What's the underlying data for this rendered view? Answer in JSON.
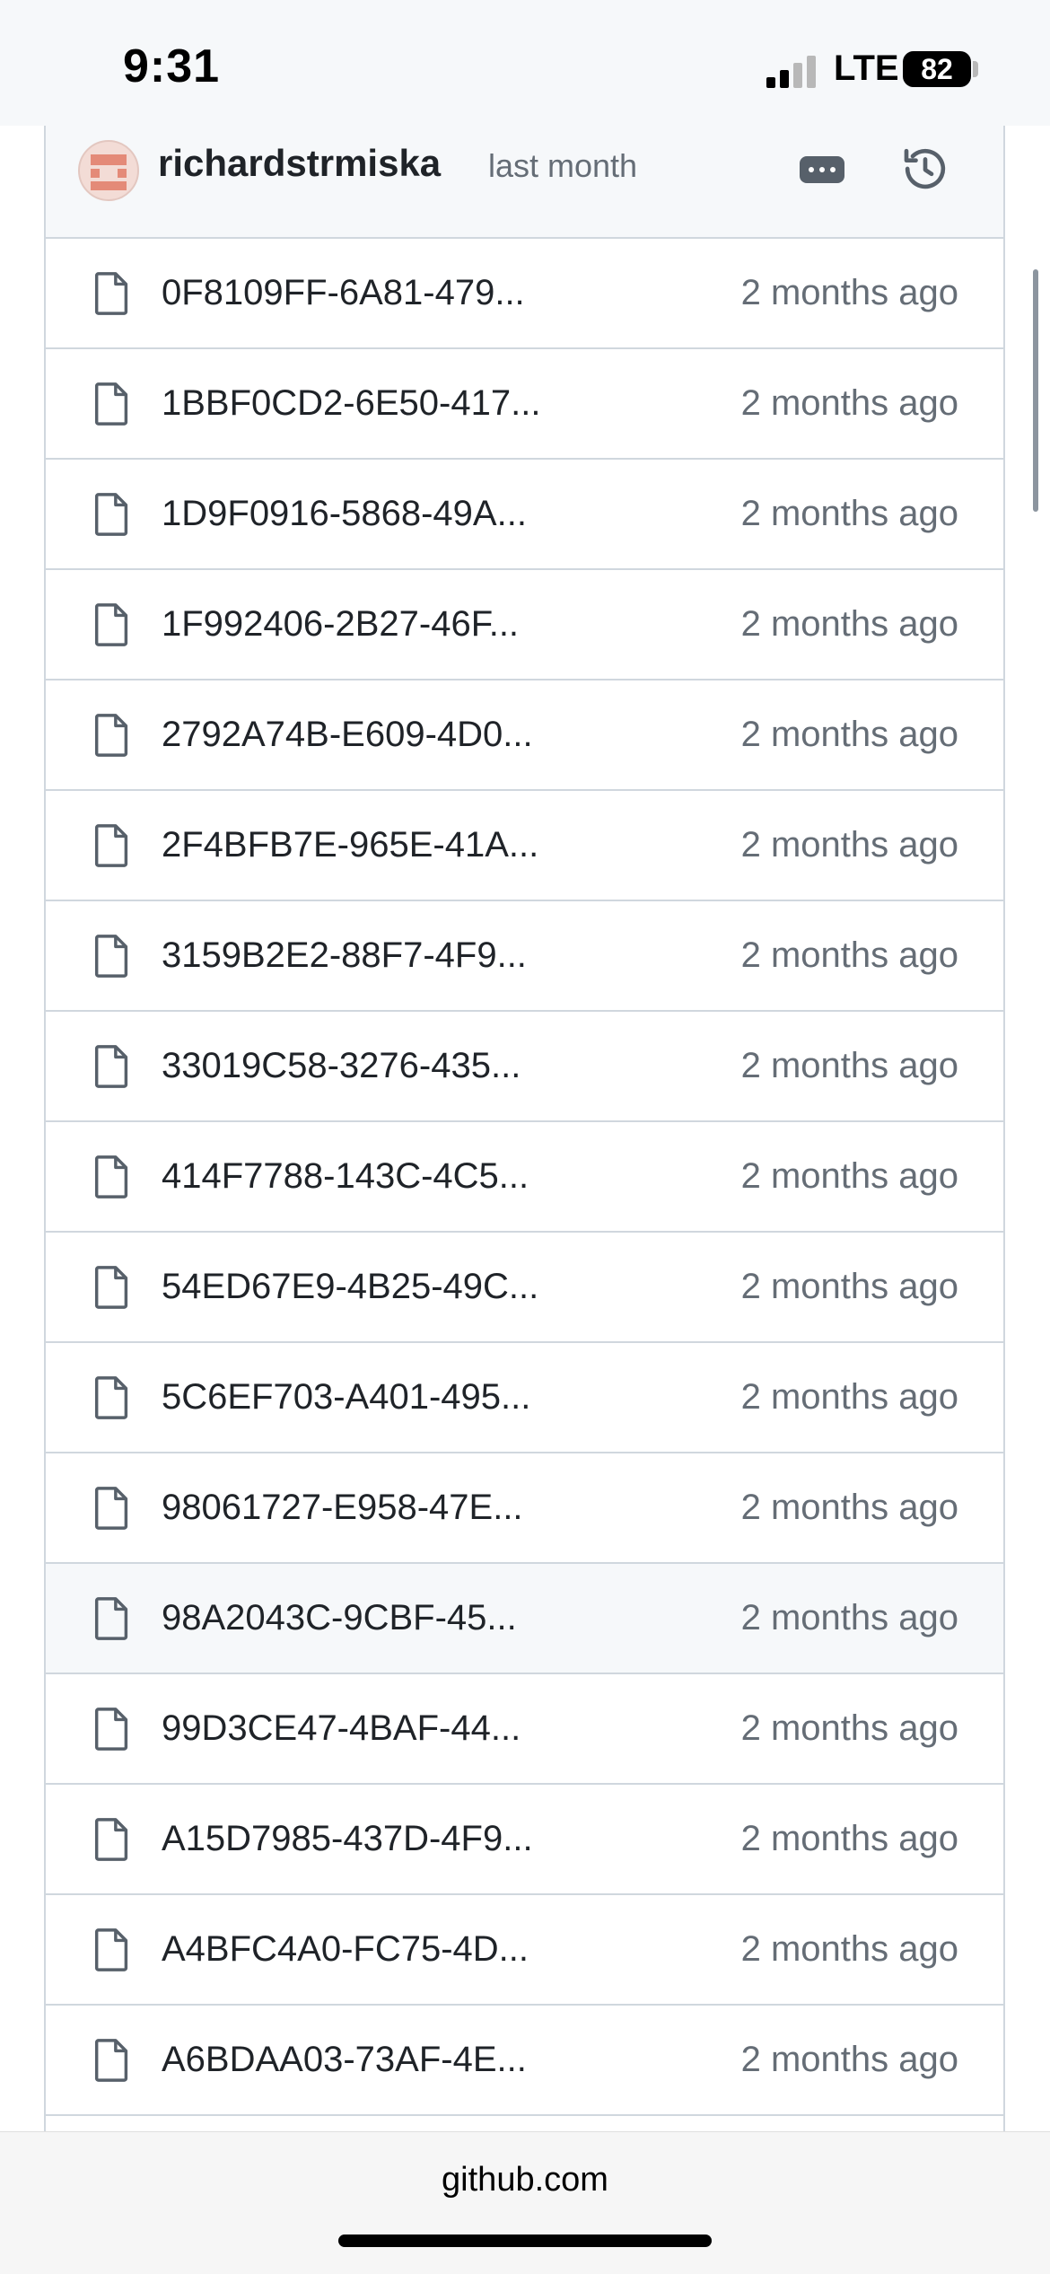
{
  "status_bar": {
    "time": "9:31",
    "network": "LTE",
    "battery": "82"
  },
  "commit": {
    "author": "richardstrmiska",
    "time": "last month"
  },
  "files": [
    {
      "name": "0F8109FF-6A81-479...",
      "age": "2 months ago"
    },
    {
      "name": "1BBF0CD2-6E50-417...",
      "age": "2 months ago"
    },
    {
      "name": "1D9F0916-5868-49A...",
      "age": "2 months ago"
    },
    {
      "name": "1F992406-2B27-46F...",
      "age": "2 months ago"
    },
    {
      "name": "2792A74B-E609-4D0...",
      "age": "2 months ago"
    },
    {
      "name": "2F4BFB7E-965E-41A...",
      "age": "2 months ago"
    },
    {
      "name": "3159B2E2-88F7-4F9...",
      "age": "2 months ago"
    },
    {
      "name": "33019C58-3276-435...",
      "age": "2 months ago"
    },
    {
      "name": "414F7788-143C-4C5...",
      "age": "2 months ago"
    },
    {
      "name": "54ED67E9-4B25-49C...",
      "age": "2 months ago"
    },
    {
      "name": "5C6EF703-A401-495...",
      "age": "2 months ago"
    },
    {
      "name": "98061727-E958-47E...",
      "age": "2 months ago"
    },
    {
      "name": "98A2043C-9CBF-45...",
      "age": "2 months ago"
    },
    {
      "name": "99D3CE47-4BAF-44...",
      "age": "2 months ago"
    },
    {
      "name": "A15D7985-437D-4F9...",
      "age": "2 months ago"
    },
    {
      "name": "A4BFC4A0-FC75-4D...",
      "age": "2 months ago"
    },
    {
      "name": "A6BDAA03-73AF-4E...",
      "age": "2 months ago"
    }
  ],
  "highlighted_row": 12,
  "url_bar": {
    "domain": "github.com"
  }
}
